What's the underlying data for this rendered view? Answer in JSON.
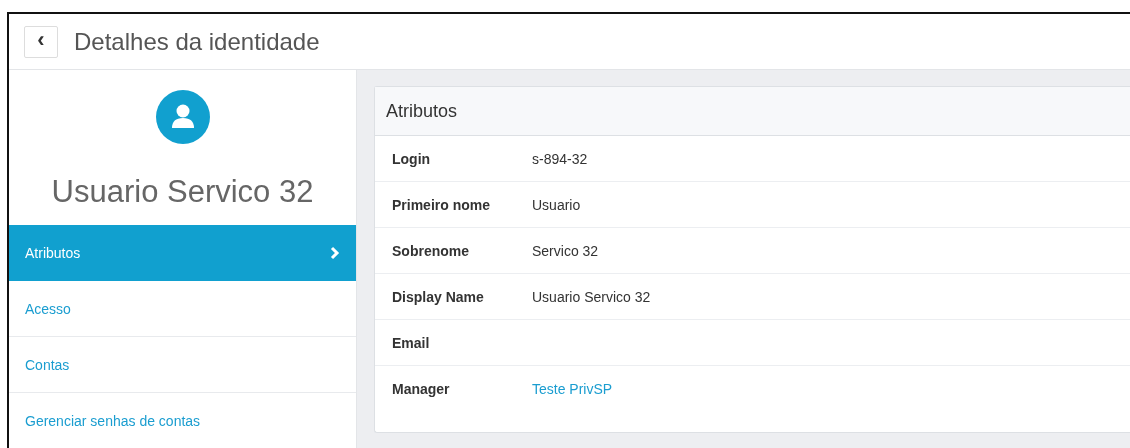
{
  "header": {
    "back_button": "‹",
    "title": "Detalhes da identidade"
  },
  "sidebar": {
    "name": "Usuario Servico 32",
    "items": [
      {
        "label": "Atributos",
        "selected": true
      },
      {
        "label": "Acesso",
        "selected": false
      },
      {
        "label": "Contas",
        "selected": false
      },
      {
        "label": "Gerenciar senhas de contas",
        "selected": false
      }
    ]
  },
  "panel": {
    "title": "Atributos",
    "rows": [
      {
        "label": "Login",
        "value": "s-894-32",
        "kind": "text"
      },
      {
        "label": "Primeiro nome",
        "value": "Usuario",
        "kind": "text"
      },
      {
        "label": "Sobrenome",
        "value": "Servico 32",
        "kind": "text"
      },
      {
        "label": "Display Name",
        "value": "Usuario Servico 32",
        "kind": "text"
      },
      {
        "label": "Email",
        "kind": "text"
      },
      {
        "label": "Manager",
        "value": "Teste PrivSP",
        "kind": "link"
      }
    ]
  }
}
